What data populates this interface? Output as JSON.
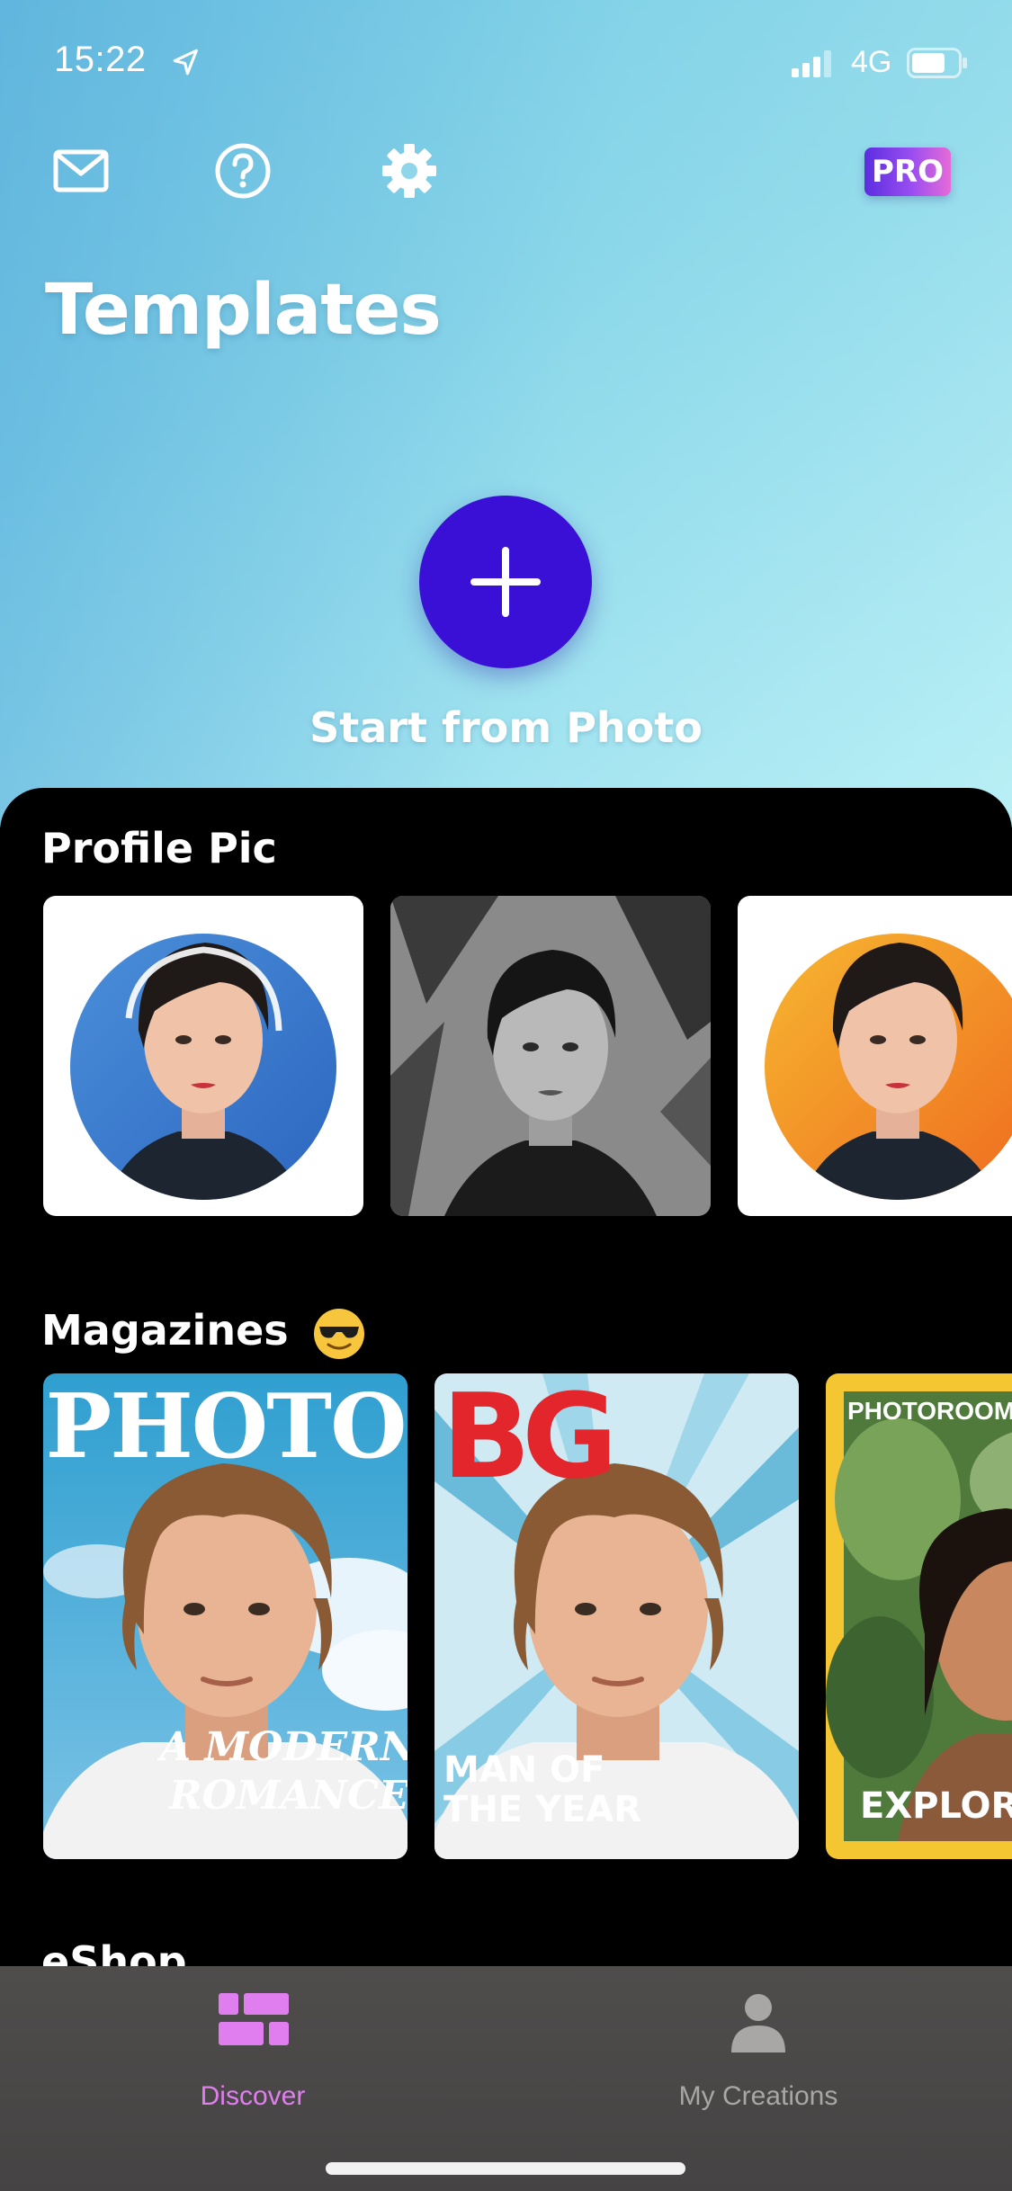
{
  "status": {
    "time": "15:22",
    "network": "4G"
  },
  "header": {
    "icons": [
      "mail-icon",
      "help-icon",
      "gear-icon"
    ],
    "pro_label": "PRO",
    "title": "Templates"
  },
  "start": {
    "label": "Start from Photo"
  },
  "sections": {
    "profile": {
      "title": "Profile Pic"
    },
    "magazines": {
      "title": "Magazines",
      "cards": [
        {
          "masthead": "PHOTO",
          "line1": "A MODERN",
          "line2": "ROMANCE"
        },
        {
          "masthead": "BG",
          "line1": "MAN OF",
          "line2": "THE YEAR"
        },
        {
          "masthead": "PHOTOROOM",
          "line1": "EXPLORE"
        }
      ]
    },
    "eshop": {
      "title": "eShop"
    }
  },
  "tabs": [
    {
      "label": "Discover",
      "icon": "grid-icon",
      "active": true
    },
    {
      "label": "My Creations",
      "icon": "person-icon",
      "active": false
    }
  ],
  "colors": {
    "fab": "#3a0fd6",
    "active_tab": "#e07ef0",
    "inactive_tab": "#a9a7a6",
    "mag_yellow": "#f4c631",
    "bg_red": "#e3262b"
  }
}
